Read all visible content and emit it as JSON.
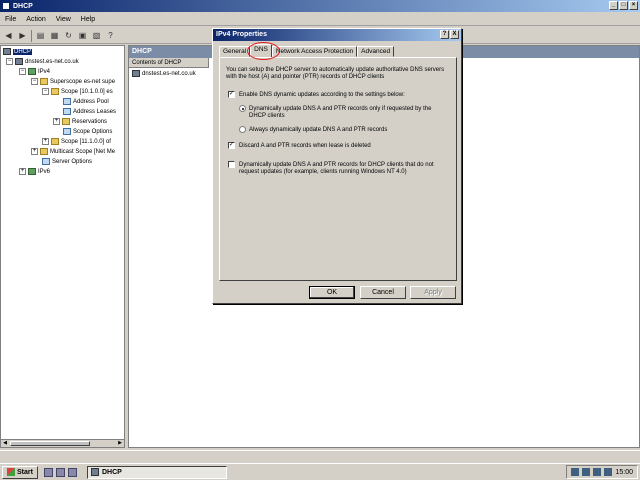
{
  "window": {
    "title": "DHCP"
  },
  "menu": [
    "File",
    "Action",
    "View",
    "Help"
  ],
  "toolbar": {
    "icons": [
      "back-icon",
      "forward-icon",
      "up-icon",
      "show-hide-tree-icon",
      "refresh-icon",
      "export-icon",
      "properties-icon",
      "help-icon"
    ]
  },
  "tree": {
    "items": [
      {
        "label": "DHCP"
      },
      {
        "label": "dnstest.es-net.co.uk"
      },
      {
        "label": "IPv4"
      },
      {
        "label": "Superscope es-net supe"
      },
      {
        "label": "Scope [10.1.0.0] es"
      },
      {
        "label": "Address Pool"
      },
      {
        "label": "Address Leases"
      },
      {
        "label": "Reservations"
      },
      {
        "label": "Scope Options"
      },
      {
        "label": "Scope [11.1.0.0] of"
      },
      {
        "label": "Multicast Scope [Net Me"
      },
      {
        "label": "Server Options"
      },
      {
        "label": "IPv6"
      }
    ]
  },
  "right": {
    "header": "DHCP",
    "column": "Contents of DHCP",
    "row": "dnstest.es-net.co.uk"
  },
  "dialog": {
    "title": "IPv4 Properties",
    "title_buttons": [
      "?",
      "X"
    ],
    "tabs": [
      "General",
      "DNS",
      "Network Access Protection",
      "Advanced"
    ],
    "intro": "You can setup the DHCP server to automatically update authoritative DNS servers with the host (A) and pointer (PTR) records of DHCP clients",
    "enable_dns": "Enable DNS dynamic updates according to the settings below:",
    "radio_requested": "Dynamically update DNS A and PTR records only if requested by the DHCP clients",
    "radio_always": "Always dynamically update DNS A and PTR records",
    "discard": "Discard A and PTR records when lease is deleted",
    "nonrequest": "Dynamically update DNS A and PTR records for DHCP clients that do not request updates (for example, clients running Windows NT 4.0)",
    "ok": "OK",
    "cancel": "Cancel",
    "apply": "Apply"
  },
  "taskbar": {
    "start": "Start",
    "task": "DHCP",
    "clock": "15:00"
  }
}
